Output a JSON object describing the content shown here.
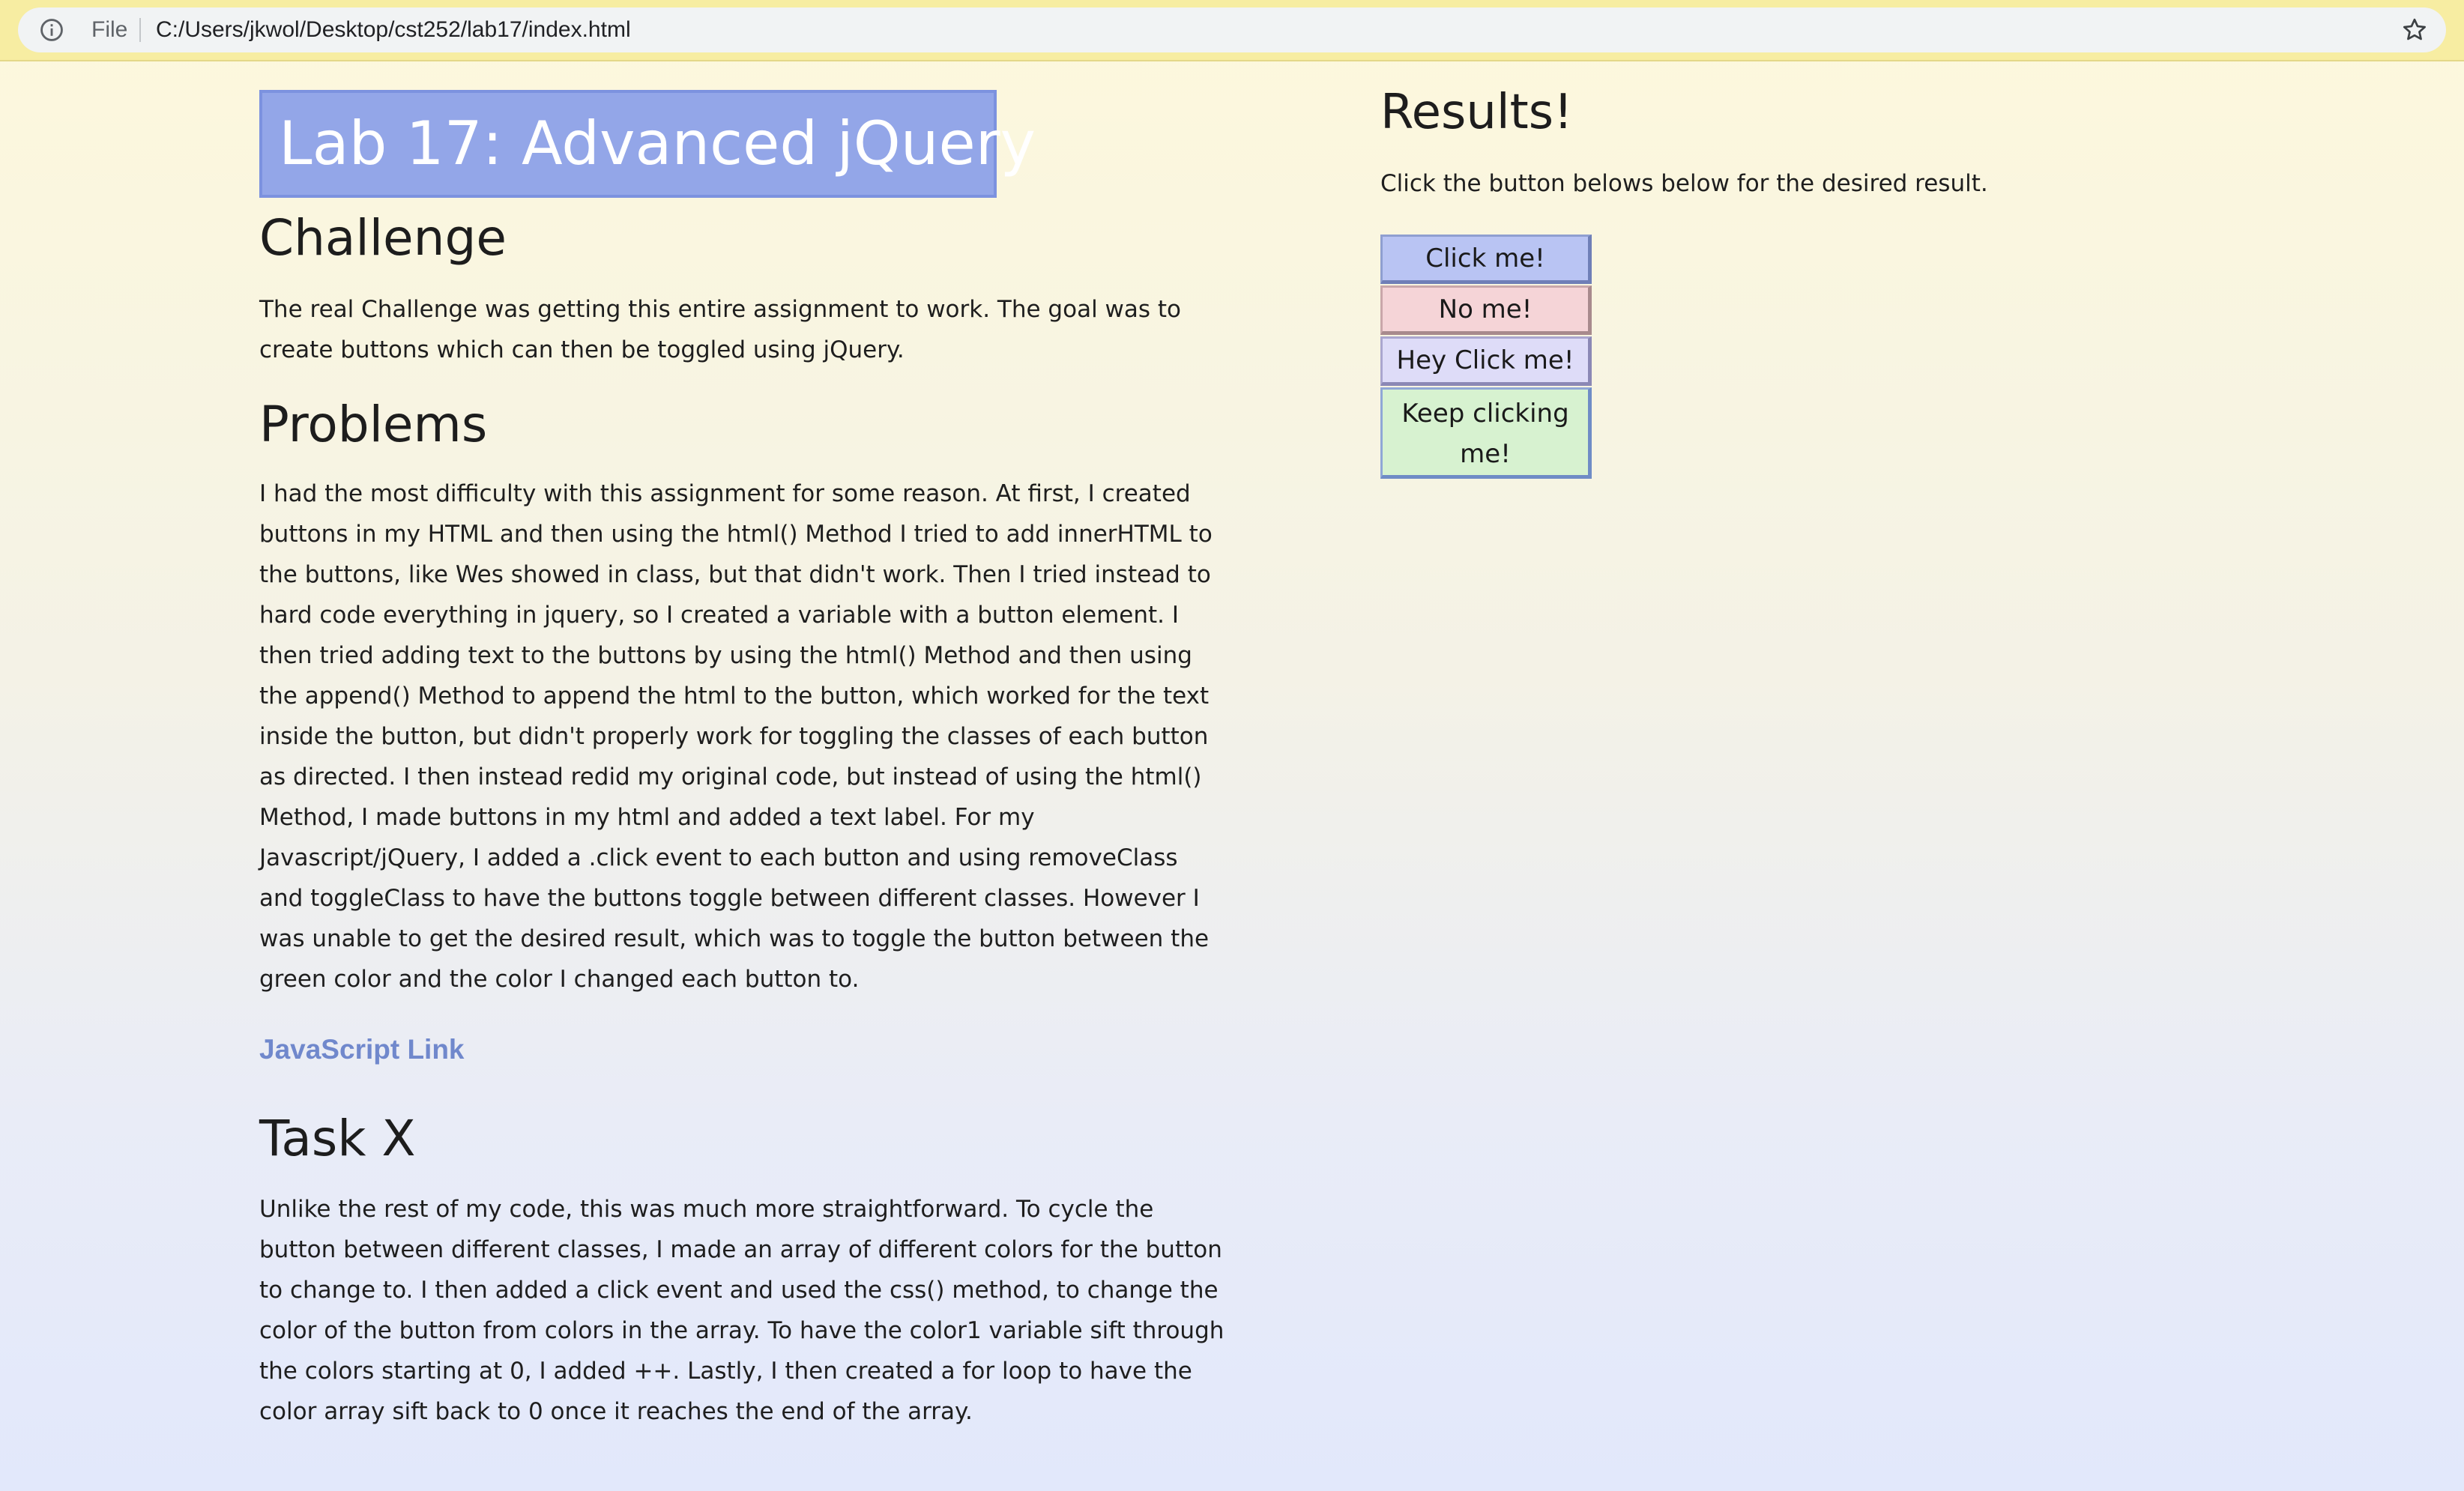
{
  "browser": {
    "scheme_label": "File",
    "url": "C:/Users/jkwol/Desktop/cst252/lab17/index.html",
    "info_icon": "info-icon",
    "bookmark_icon": "star-icon"
  },
  "page": {
    "title": "Lab 17: Advanced jQuery",
    "challenge": {
      "heading": "Challenge",
      "text": "The real Challenge was getting this entire assignment to work. The goal was to create buttons which can then be toggled using jQuery."
    },
    "problems": {
      "heading": "Problems",
      "text": "I had the most difficulty with this assignment for some reason. At first, I created buttons in my HTML and then using the html() Method I tried to add innerHTML to the buttons, like Wes showed in class, but that didn't work. Then I tried instead to hard code everything in jquery, so I created a variable with a button element. I then tried adding text to the buttons by using the html() Method and then using the append() Method to append the html to the button, which worked for the text inside the button, but didn't properly work for toggling the classes of each button as directed. I then instead redid my original code, but instead of using the html() Method, I made buttons in my html and added a text label. For my Javascript/jQuery, I added a .click event to each button and using removeClass and toggleClass to have the buttons toggle between different classes. However I was unable to get the desired result, which was to toggle the button between the green color and the color I changed each button to."
    },
    "js_link": "JavaScript Link",
    "task_x": {
      "heading": "Task X",
      "text": "Unlike the rest of my code, this was much more straightforward. To cycle the button between different classes, I made an array of different colors for the button to change to. I then added a click event and used the css() method, to change the color of the button from colors in the array. To have the color1 variable sift through the colors starting at 0, I added ++. Lastly, I then created a for loop to have the color array sift back to 0 once it reaches the end of the array."
    }
  },
  "results": {
    "heading": "Results!",
    "instructions": "Click the button belows below for the desired result.",
    "buttons": [
      {
        "label": "Click me!",
        "color": "#b9c4f3"
      },
      {
        "label": "No me!",
        "color": "#f5d4d7"
      },
      {
        "label": "Hey Click me!",
        "color": "#dedcf8"
      },
      {
        "label": "Keep clicking me!",
        "color": "#d7f2d0"
      }
    ]
  },
  "colors": {
    "title_box": "#93a6e8",
    "link": "#7088cc",
    "address_bar": "#f7eda2"
  }
}
